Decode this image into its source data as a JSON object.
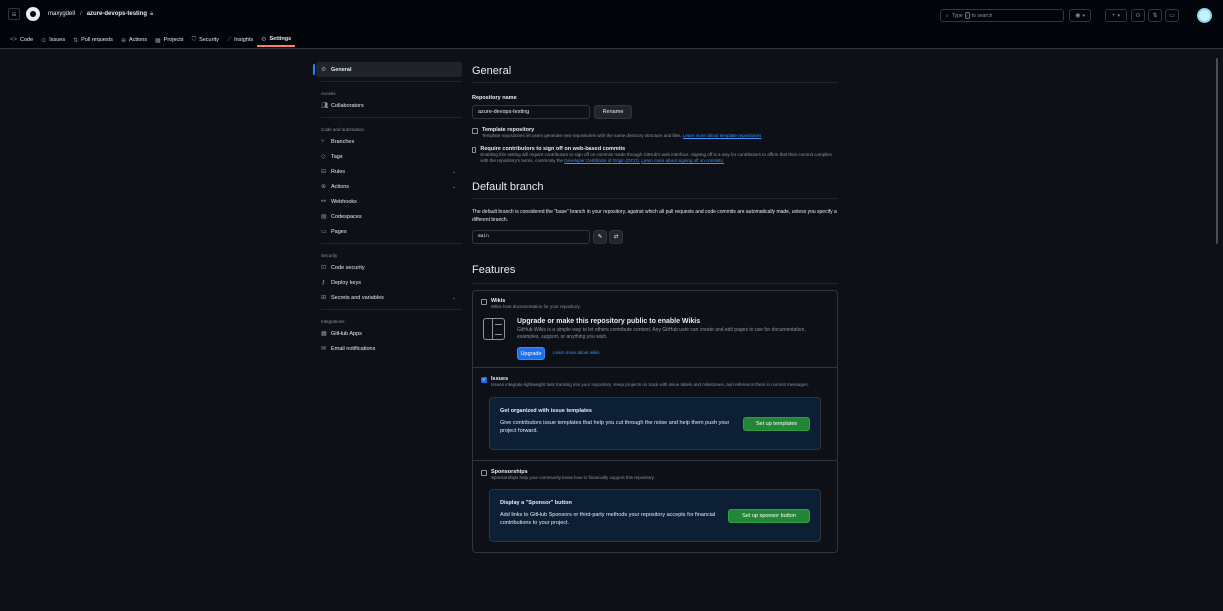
{
  "header": {
    "owner": "maxygdell",
    "separator": "/",
    "repo": "azure-devops-testing",
    "search_prefix": "Type",
    "search_key": "/",
    "search_suffix": "to search"
  },
  "tabs": [
    {
      "label": "Code",
      "icon": "<>"
    },
    {
      "label": "Issues",
      "icon": "⊙"
    },
    {
      "label": "Pull requests",
      "icon": "⇅"
    },
    {
      "label": "Actions",
      "icon": "⊕"
    },
    {
      "label": "Projects",
      "icon": "▦"
    },
    {
      "label": "Security",
      "icon": "⛉"
    },
    {
      "label": "Insights",
      "icon": "⟋"
    },
    {
      "label": "Settings",
      "icon": "⚙"
    }
  ],
  "sidebar": {
    "general": "General",
    "group_access": "Access",
    "collaborators": "Collaborators",
    "group_code": "Code and automation",
    "branches": "Branches",
    "tags": "Tags",
    "rules": "Rules",
    "actions": "Actions",
    "webhooks": "Webhooks",
    "codespaces": "Codespaces",
    "pages": "Pages",
    "group_security": "Security",
    "code_security": "Code security",
    "deploy_keys": "Deploy keys",
    "secrets": "Secrets and variables",
    "group_integrations": "Integrations",
    "github_apps": "GitHub Apps",
    "email_notifications": "Email notifications"
  },
  "general": {
    "title": "General",
    "repo_name_label": "Repository name",
    "repo_name_value": "azure-devops-testing",
    "rename_button": "Rename",
    "template_label": "Template repository",
    "template_desc": "Template repositories let users generate new repositories with the same directory structure and files.",
    "template_link": "Learn more about template repositories",
    "signoff_label": "Require contributors to sign off on web-based commits",
    "signoff_desc": "Enabling this setting will require contributors to sign off on commits made through GitHub's web interface. Signing off is a way for contributors to affirm that their commit complies with the repository's terms, commonly the",
    "signoff_link1": "Developer Certificate of Origin (DCO).",
    "signoff_link2": "Learn more about signing off on commits."
  },
  "default_branch": {
    "title": "Default branch",
    "desc": "The default branch is considered the \"base\" branch in your repository, against which all pull requests and code commits are automatically made, unless you specify a different branch.",
    "branch_value": "main"
  },
  "features": {
    "title": "Features",
    "wikis_label": "Wikis",
    "wikis_desc": "Wikis host documentation for your repository.",
    "wikis_upgrade_title": "Upgrade or make this repository public to enable Wikis",
    "wikis_upgrade_desc": "GitHub Wikis is a simple way to let others contribute content. Any GitHub user can create and edit pages to use for documentation, examples, support, or anything you wish.",
    "upgrade_button": "Upgrade",
    "wikis_learn": "Learn more about wikis",
    "issues_label": "Issues",
    "issues_desc": "Issues integrate lightweight task tracking into your repository. Keep projects on track with issue labels and milestones, and reference them in commit messages.",
    "issues_card_title": "Get organized with issue templates",
    "issues_card_desc": "Give contributors issue templates that help you cut through the noise and help them push your project forward.",
    "issues_card_button": "Set up templates",
    "sponsorships_label": "Sponsorships",
    "sponsorships_desc": "Sponsorships help your community know how to financially support this repository.",
    "sponsor_card_title": "Display a \"Sponsor\" button",
    "sponsor_card_desc": "Add links to GitHub Sponsors or third-party methods your repository accepts for financial contributions to your project.",
    "sponsor_card_button": "Set up sponsor button"
  }
}
